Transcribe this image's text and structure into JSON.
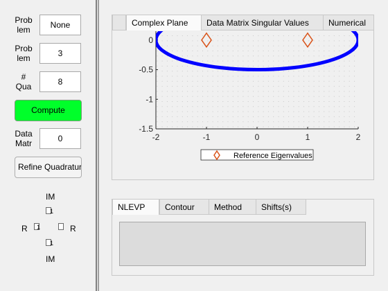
{
  "left_panel": {
    "fields": [
      {
        "label_line1": "Prob",
        "label_line2": "lem",
        "value": "None"
      },
      {
        "label_line1": "Prob",
        "label_line2": "lem",
        "value": "3"
      },
      {
        "label_line1": "#",
        "label_line2": "Qua",
        "value": "8"
      },
      {
        "label_line1": "Data",
        "label_line2": "Matr",
        "value": "0"
      }
    ],
    "compute_label": "Compute",
    "refine_label": "Refine Quadratur",
    "compute_color": "#00ff2a",
    "pad": {
      "top_label": "IM",
      "bottom_label": "IM",
      "left_label": "R",
      "right_label": "R",
      "top_box": "1",
      "bottom_box": "1",
      "left_box": "1",
      "right_box": ""
    }
  },
  "top_tabs": [
    "Complex Plane",
    "Data Matrix Singular Values",
    "Numerical"
  ],
  "bottom_tabs": [
    "NLEVP",
    "Contour",
    "Method",
    "Shifts(s)"
  ],
  "chart_data": {
    "type": "scatter",
    "xlim": [
      -2,
      2
    ],
    "ylim": [
      -1.5,
      0.15
    ],
    "x_ticks": [
      "-2",
      "-1",
      "0",
      "1",
      "2"
    ],
    "y_ticks": [
      "0",
      "-0.5",
      "-1",
      "-1.5"
    ],
    "y_tick_values": [
      0,
      -0.5,
      -1,
      -1.5
    ],
    "grid": "dotted minor",
    "contour": {
      "type": "ellipse",
      "center": [
        0,
        0
      ],
      "rx": 2,
      "ry": 0.5,
      "color": "#0000ff"
    },
    "series": [
      {
        "name": "Reference Eigenvalues",
        "marker": "diamond",
        "color": "#d95319",
        "points": [
          [
            -1,
            0
          ],
          [
            1,
            0
          ]
        ]
      }
    ],
    "legend_position": "bottom-center"
  }
}
